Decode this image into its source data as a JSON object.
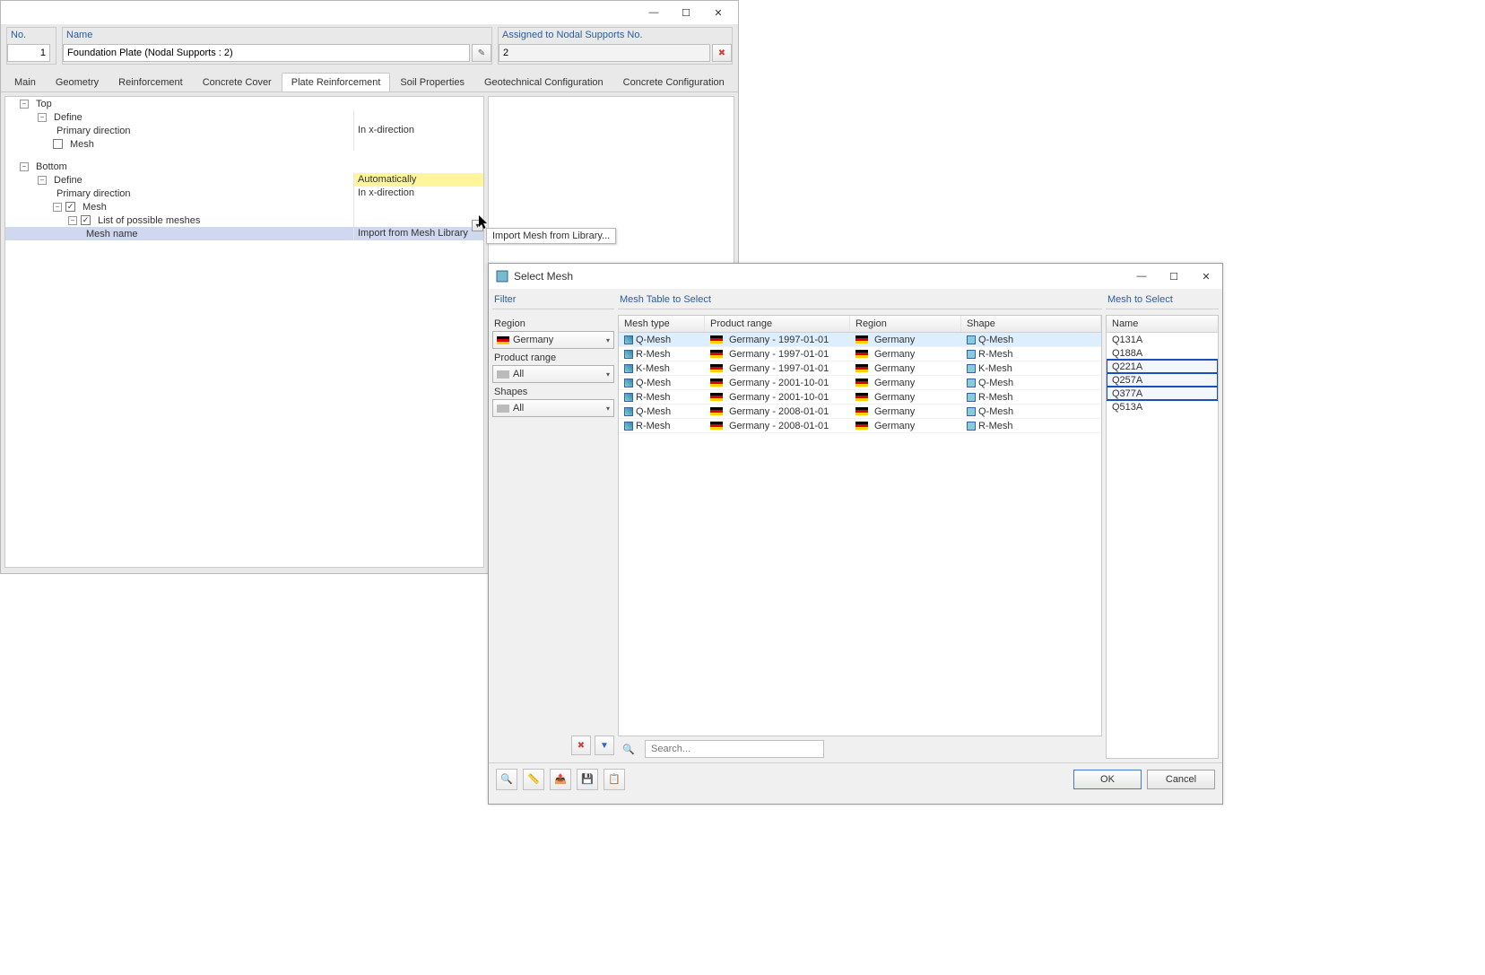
{
  "win1": {
    "header": {
      "no_label": "No.",
      "no_value": "1",
      "name_label": "Name",
      "name_value": "Foundation Plate (Nodal Supports : 2)",
      "assigned_label": "Assigned to Nodal Supports No.",
      "assigned_value": "2"
    },
    "tabs": [
      "Main",
      "Geometry",
      "Reinforcement",
      "Concrete Cover",
      "Plate Reinforcement",
      "Soil Properties",
      "Geotechnical Configuration",
      "Concrete Configuration"
    ],
    "tree": {
      "top": "Top",
      "bottom": "Bottom",
      "define": "Define",
      "primary_dir": "Primary direction",
      "mesh": "Mesh",
      "list_meshes": "List of possible meshes",
      "mesh_name": "Mesh name",
      "val_auto": "Automatically",
      "val_inx": "In x-direction",
      "val_import": "Import from Mesh Library"
    },
    "tooltip": "Import Mesh from Library..."
  },
  "dialog": {
    "title": "Select Mesh",
    "filter_hdr": "Filter",
    "region_lbl": "Region",
    "region_val": "Germany",
    "prodrange_lbl": "Product range",
    "prodrange_val": "All",
    "shapes_lbl": "Shapes",
    "shapes_val": "All",
    "table_hdr": "Mesh Table to Select",
    "cols": {
      "meshtype": "Mesh type",
      "prodrange": "Product range",
      "region": "Region",
      "shape": "Shape"
    },
    "rows": [
      {
        "type": "Q-Mesh",
        "range": "Germany - 1997-01-01",
        "region": "Germany",
        "shape": "Q-Mesh",
        "sel": true
      },
      {
        "type": "R-Mesh",
        "range": "Germany - 1997-01-01",
        "region": "Germany",
        "shape": "R-Mesh"
      },
      {
        "type": "K-Mesh",
        "range": "Germany - 1997-01-01",
        "region": "Germany",
        "shape": "K-Mesh"
      },
      {
        "type": "Q-Mesh",
        "range": "Germany - 2001-10-01",
        "region": "Germany",
        "shape": "Q-Mesh"
      },
      {
        "type": "R-Mesh",
        "range": "Germany - 2001-10-01",
        "region": "Germany",
        "shape": "R-Mesh"
      },
      {
        "type": "Q-Mesh",
        "range": "Germany - 2008-01-01",
        "region": "Germany",
        "shape": "Q-Mesh"
      },
      {
        "type": "R-Mesh",
        "range": "Germany - 2008-01-01",
        "region": "Germany",
        "shape": "R-Mesh"
      }
    ],
    "select_hdr": "Mesh to Select",
    "name_col": "Name",
    "names": [
      {
        "n": "Q131A"
      },
      {
        "n": "Q188A"
      },
      {
        "n": "Q221A",
        "m": true
      },
      {
        "n": "Q257A",
        "m": true
      },
      {
        "n": "Q377A",
        "m": true
      },
      {
        "n": "Q513A"
      }
    ],
    "search_ph": "Search...",
    "ok": "OK",
    "cancel": "Cancel"
  }
}
